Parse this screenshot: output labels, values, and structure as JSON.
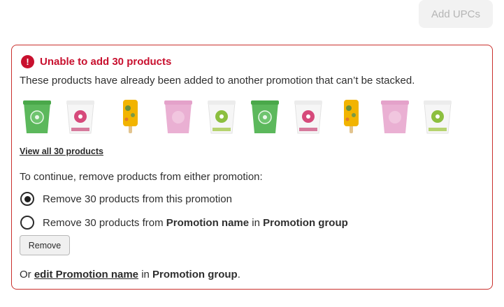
{
  "toolbar": {
    "add_upcs_label": "Add UPCs"
  },
  "error": {
    "title": "Unable to add 30 products",
    "description": "These products have already been added to another promotion that can’t be stacked.",
    "view_all": "View all 30 products",
    "instruction": "To continue, remove products from either promotion:",
    "option1": "Remove 30 products from this promotion",
    "option2_prefix": "Remove 30 products from ",
    "promotion_name": "Promotion name",
    "in_word": " in ",
    "promotion_group": "Promotion group",
    "remove_label": "Remove",
    "or_prefix": "Or ",
    "edit_link": "edit Promotion name",
    "or_suffix": " in ",
    "period": "."
  },
  "products": [
    {
      "kind": "tub",
      "color": "#5cb85c",
      "label": "green tub"
    },
    {
      "kind": "tub",
      "color": "#d64a7b",
      "label": "white-pink tub"
    },
    {
      "kind": "pop",
      "color": "#f2b400",
      "label": "popsicle"
    },
    {
      "kind": "tub",
      "color": "#e8a9cf",
      "label": "pink tub"
    },
    {
      "kind": "tub",
      "color": "#8cbf3f",
      "label": "white-green tub"
    },
    {
      "kind": "tub",
      "color": "#5cb85c",
      "label": "green tub"
    },
    {
      "kind": "tub",
      "color": "#d64a7b",
      "label": "white-pink tub"
    },
    {
      "kind": "pop",
      "color": "#f2b400",
      "label": "popsicle"
    },
    {
      "kind": "tub",
      "color": "#e8a9cf",
      "label": "pink tub"
    },
    {
      "kind": "tub",
      "color": "#8cbf3f",
      "label": "white-green tub"
    }
  ],
  "selected_option": 1,
  "colors": {
    "error": "#c8102e",
    "border": "#c9302c"
  }
}
